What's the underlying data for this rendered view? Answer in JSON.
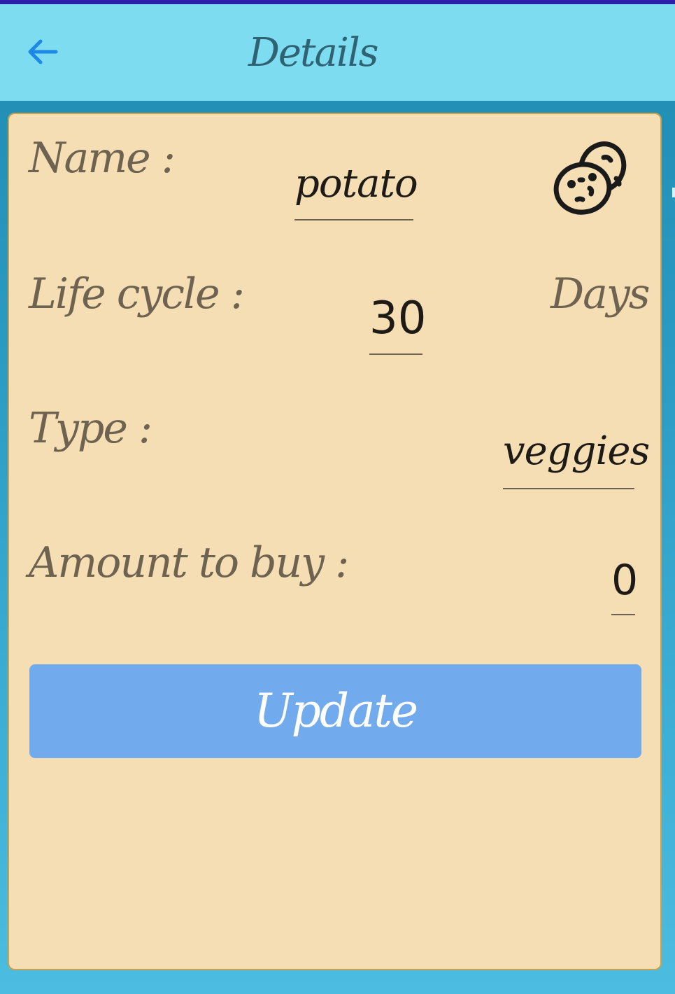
{
  "app_bar": {
    "title": "Details",
    "back_icon": "arrow-left-icon",
    "background": "#7ddcf0",
    "title_color": "#2f6273",
    "back_color": "#1e88e5"
  },
  "form": {
    "name": {
      "label": "Name :",
      "value": "potato",
      "icon": "potato-icon"
    },
    "life_cycle": {
      "label": "Life cycle :",
      "value": "30",
      "unit": "Days"
    },
    "type": {
      "label": "Type :",
      "value": "veggies"
    },
    "amount": {
      "label": "Amount to buy :",
      "value": "0"
    }
  },
  "update_button": {
    "label": "Update",
    "color": "#72aaee"
  },
  "colors": {
    "card": "#f5deb3",
    "card_border": "#c9a24e",
    "label_text": "#6e6250",
    "value_text": "#1e1a16",
    "status_strip": "#2a1fa6"
  }
}
